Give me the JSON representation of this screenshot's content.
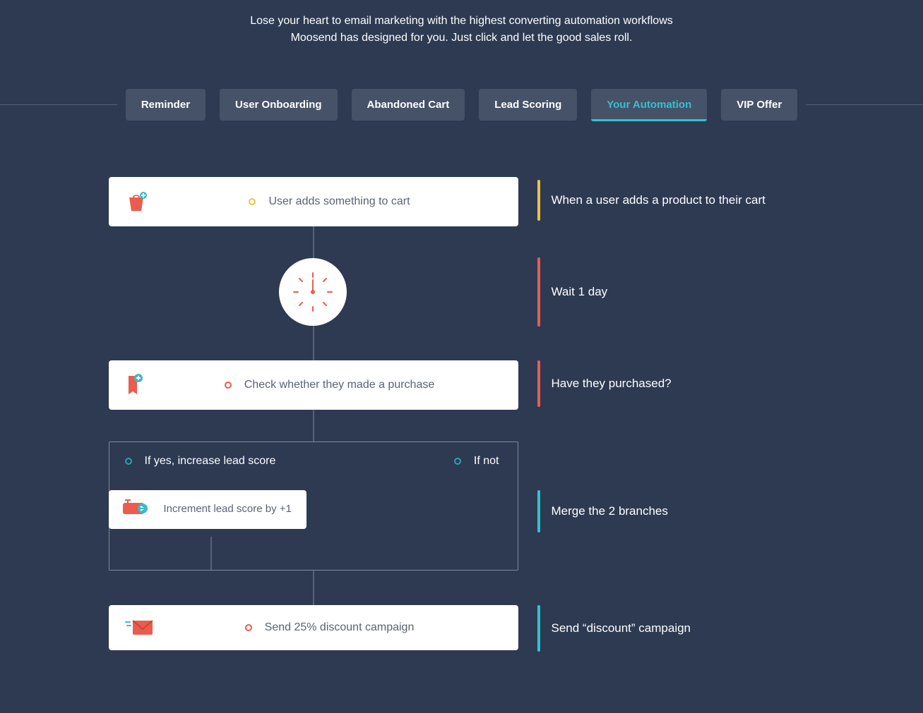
{
  "header": {
    "subtitle": "Lose your heart to email marketing with the highest converting automation workflows Moosend has designed for you. Just click and let the good sales roll."
  },
  "tabs": [
    {
      "label": "Reminder"
    },
    {
      "label": "User Onboarding"
    },
    {
      "label": "Abandoned Cart"
    },
    {
      "label": "Lead Scoring"
    },
    {
      "label": "Your Automation",
      "active": true
    },
    {
      "label": "VIP Offer"
    }
  ],
  "flow": {
    "step1": {
      "label": "User adds something to cart",
      "desc": "When a user adds a product to their cart",
      "color": "yellow"
    },
    "step2": {
      "desc": "Wait 1 day",
      "color": "red"
    },
    "step3": {
      "label": "Check whether they made a purchase",
      "desc": "Have they purchased?",
      "color": "red"
    },
    "branch": {
      "yes_label": "If yes, increase lead score",
      "no_label": "If not",
      "mini_label": "Increment lead score by +1",
      "desc": "Merge the 2 branches",
      "color": "teal"
    },
    "step4": {
      "label": "Send 25% discount campaign",
      "desc": "Send “discount” campaign",
      "color": "teal"
    }
  }
}
